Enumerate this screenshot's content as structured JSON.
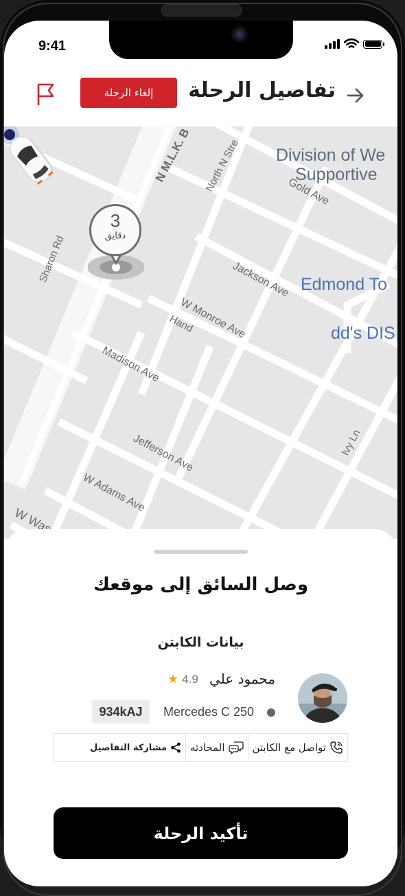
{
  "status_bar": {
    "time": "9:41"
  },
  "header": {
    "title": "تفاصيل الرحلة",
    "cancel_label": "إلغاء الرحلة"
  },
  "map": {
    "eta_value": "3",
    "eta_unit": "دقايق",
    "street_labels": [
      "N M.L.K. B",
      "North N Stre",
      "Sharon Rd",
      "Gold Ave",
      "Jackson Ave",
      "W Monroe Ave",
      "Hand",
      "Madison Ave",
      "Jefferson Ave",
      "W Adams Ave",
      "W Was",
      "Ivy Ln"
    ],
    "poi_labels": [
      "Division of We",
      "Supportive",
      "Edmond To",
      "dd's DIS"
    ]
  },
  "sheet": {
    "arrival_message": "وصل السائق إلى موقعك",
    "captain_section_title": "بيانات الكابتن",
    "driver_name": "محمود علي",
    "rating": "4.9",
    "car_model": "Mercedes C 250",
    "plate": "934kAJ",
    "actions": [
      {
        "label": "تواصل مع الكابتن",
        "icon": "phone-call-icon"
      },
      {
        "label": "المحادثه",
        "icon": "chat-icon"
      },
      {
        "label": "مشاركة التفاصيل",
        "icon": "share-icon"
      }
    ],
    "confirm_label": "تأكيد الرحلة"
  },
  "colors": {
    "accent_red": "#d0242b",
    "star": "#f5a623",
    "map_bg": "#e6e6e6",
    "road": "#ffffff",
    "poi_text": "#4b74b8"
  }
}
